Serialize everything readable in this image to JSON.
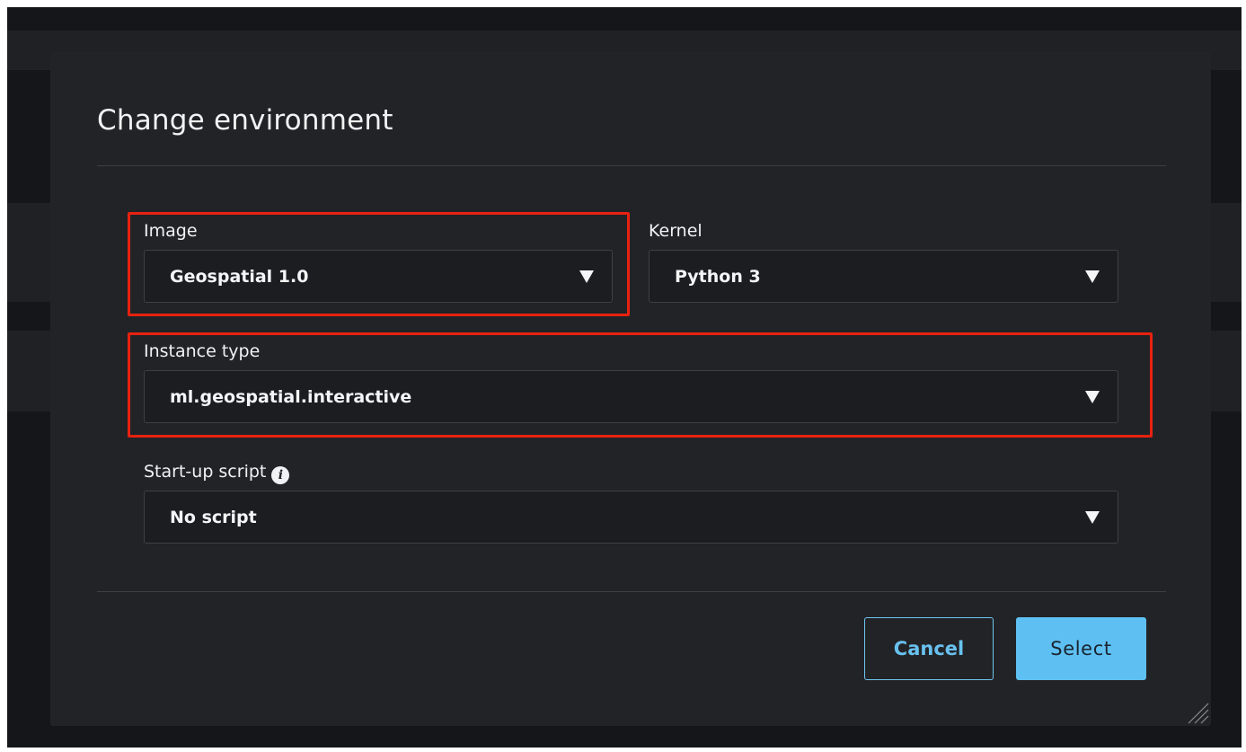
{
  "dialog": {
    "title": "Change environment"
  },
  "fields": {
    "image": {
      "label": "Image",
      "value": "Geospatial 1.0"
    },
    "kernel": {
      "label": "Kernel",
      "value": "Python 3"
    },
    "instance_type": {
      "label": "Instance type",
      "value": "ml.geospatial.interactive"
    },
    "startup_script": {
      "label": "Start-up script",
      "value": "No script",
      "info_icon": "info-icon"
    }
  },
  "buttons": {
    "cancel": "Cancel",
    "select": "Select"
  },
  "colors": {
    "dialog_bg": "#222327",
    "highlight": "#e8220f",
    "accent": "#5ec0f2"
  }
}
